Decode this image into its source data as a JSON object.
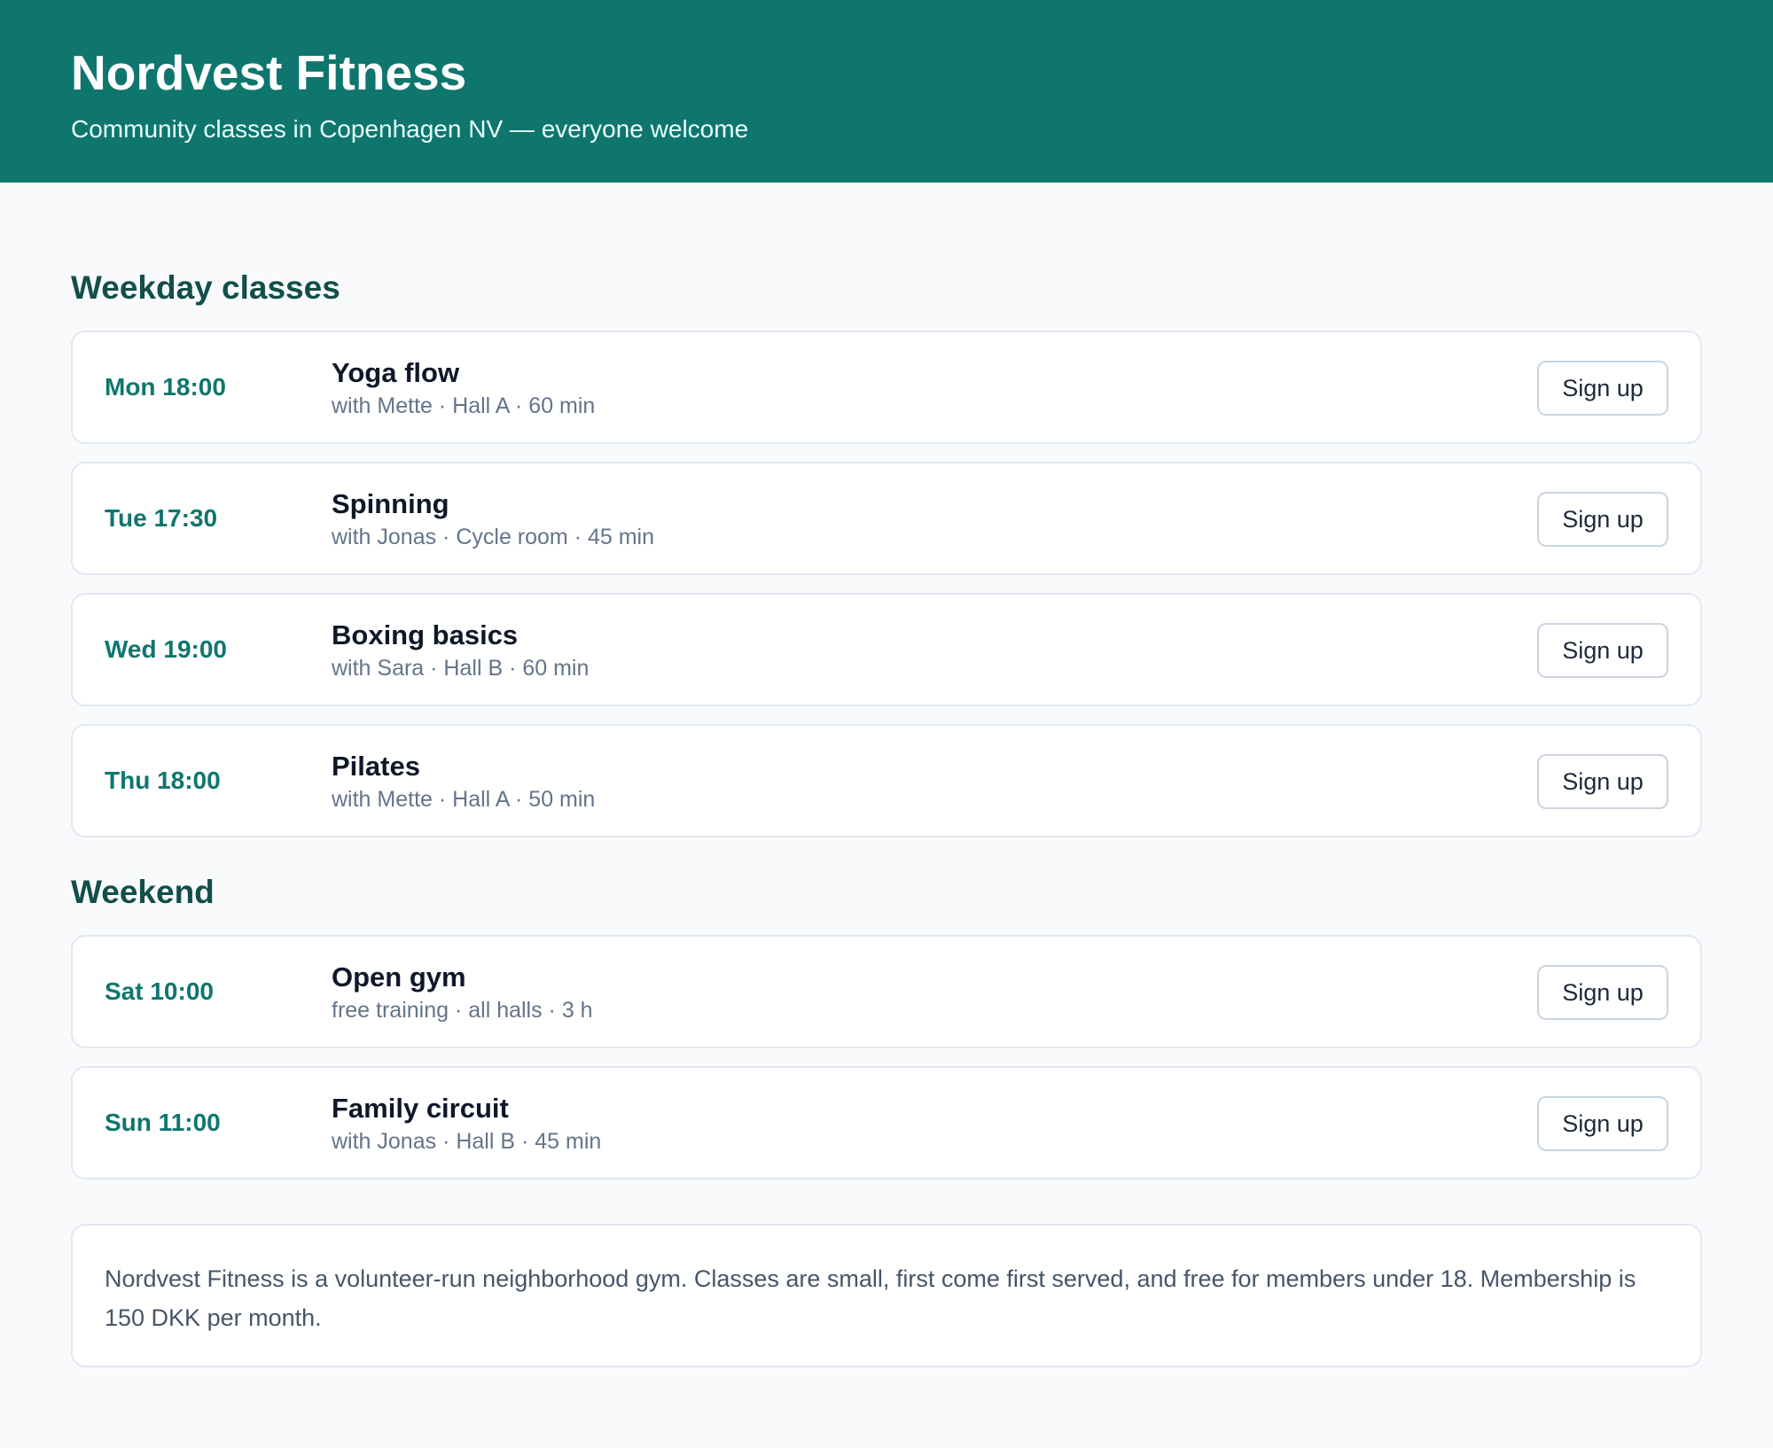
{
  "header": {
    "title": "Nordvest Fitness",
    "subtitle": "Community classes in Copenhagen NV — everyone welcome"
  },
  "colors": {
    "brand": "#0f766e",
    "section_heading": "#134e4a",
    "page_background": "#f8fafc"
  },
  "sections": [
    {
      "title": "Weekday classes",
      "classes": [
        {
          "time": "Mon 18:00",
          "name": "Yoga flow",
          "meta": "with Mette · Hall A · 60 min",
          "button": "Sign up"
        },
        {
          "time": "Tue 17:30",
          "name": "Spinning",
          "meta": "with Jonas · Cycle room · 45 min",
          "button": "Sign up"
        },
        {
          "time": "Wed 19:00",
          "name": "Boxing basics",
          "meta": "with Sara · Hall B · 60 min",
          "button": "Sign up"
        },
        {
          "time": "Thu 18:00",
          "name": "Pilates",
          "meta": "with Mette · Hall A · 50 min",
          "button": "Sign up"
        }
      ]
    },
    {
      "title": "Weekend",
      "classes": [
        {
          "time": "Sat 10:00",
          "name": "Open gym",
          "meta": "free training · all halls · 3 h",
          "button": "Sign up"
        },
        {
          "time": "Sun 11:00",
          "name": "Family circuit",
          "meta": "with Jonas · Hall B · 45 min",
          "button": "Sign up"
        }
      ]
    }
  ],
  "about": {
    "text": "Nordvest Fitness is a volunteer-run neighborhood gym. Classes are small, first come first served, and free for members under 18. Membership is 150 DKK per month."
  }
}
